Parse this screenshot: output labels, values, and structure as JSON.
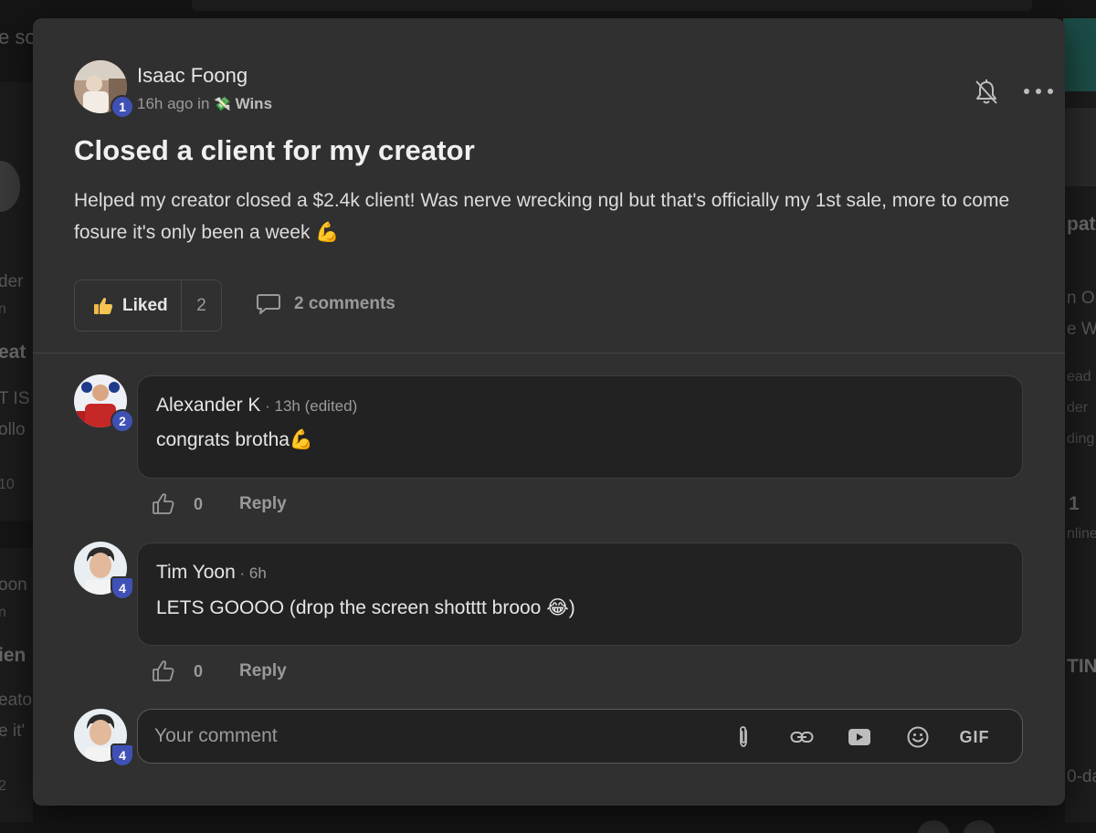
{
  "background": {
    "fragments": [
      "e so",
      "der",
      "n",
      "eat",
      "T IS",
      "ollo",
      "10",
      "oon",
      "n",
      "ien",
      "eato",
      "e it'",
      "2",
      "pat",
      "n Op",
      "e W",
      "ead",
      "der",
      "ding",
      "1",
      "nline",
      "TIN",
      "0-da"
    ]
  },
  "post": {
    "author": "Isaac Foong",
    "author_level": "1",
    "time": "16h ago in",
    "category_emoji": "💸",
    "category": "Wins",
    "title": "Closed a client for my creator",
    "body": "Helped my creator closed a $2.4k client! Was nerve wrecking ngl but that's officially my 1st sale, more to come fosure it's only been a week 💪",
    "liked_label": "Liked",
    "like_count": "2",
    "comments_label": "2 comments"
  },
  "comments": [
    {
      "author": "Alexander K",
      "meta": " · 13h (edited)",
      "level": "2",
      "text": "congrats brotha💪",
      "like_count": "0",
      "reply_label": "Reply"
    },
    {
      "author": "Tim Yoon",
      "meta": " · 6h",
      "level": "4",
      "text": "LETS GOOOO (drop the screen shotttt brooo 😂)",
      "like_count": "0",
      "reply_label": "Reply"
    }
  ],
  "composer": {
    "placeholder": "Your comment",
    "user_level": "4",
    "gif_label": "GIF"
  },
  "colors": {
    "modal_bg": "#303030",
    "bubble_bg": "#222222",
    "badge_blue": "#3f51b5",
    "muted_text": "#9a9a9a"
  }
}
